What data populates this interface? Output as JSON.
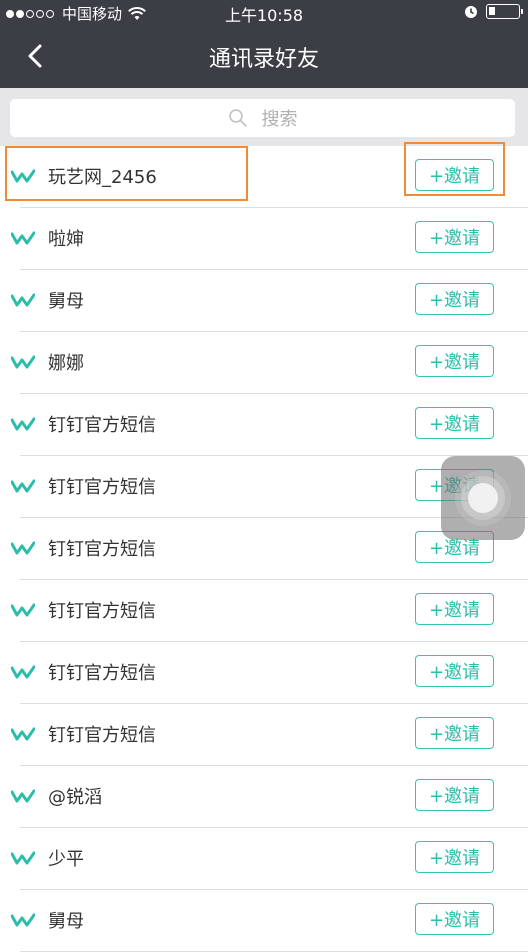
{
  "status_bar": {
    "carrier": "中国移动",
    "time": "上午10:58"
  },
  "nav": {
    "title": "通讯录好友"
  },
  "search": {
    "placeholder": "搜索"
  },
  "invite_label": "+邀请",
  "contacts": [
    {
      "name": "玩艺网_2456"
    },
    {
      "name": "啦婶"
    },
    {
      "name": "舅母"
    },
    {
      "name": "娜娜"
    },
    {
      "name": "钉钉官方短信"
    },
    {
      "name": "钉钉官方短信"
    },
    {
      "name": "钉钉官方短信"
    },
    {
      "name": "钉钉官方短信"
    },
    {
      "name": "钉钉官方短信"
    },
    {
      "name": "钉钉官方短信"
    },
    {
      "name": "@锐滔"
    },
    {
      "name": "少平"
    },
    {
      "name": "舅母"
    }
  ],
  "colors": {
    "nav_bg": "#3b3e45",
    "accent": "#2bbdaa",
    "highlight": "#f08b3a"
  }
}
